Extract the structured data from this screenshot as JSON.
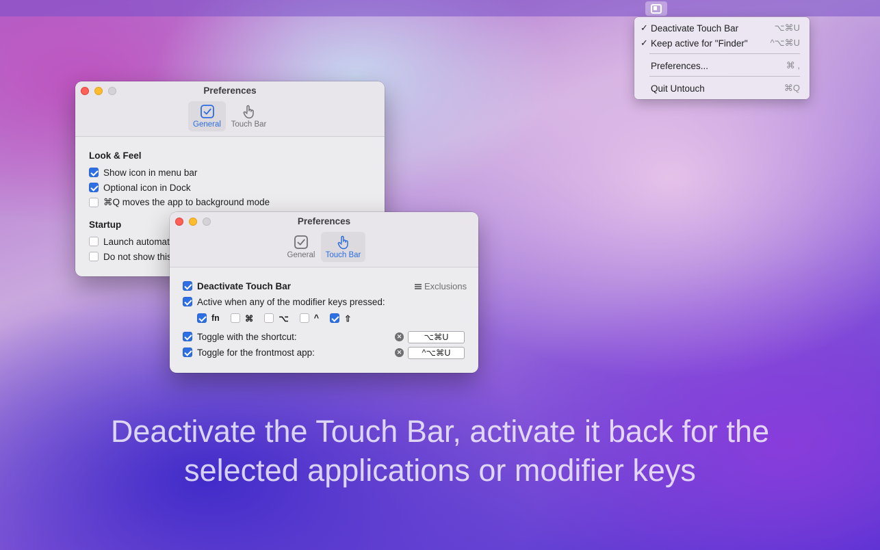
{
  "menubar": {
    "icon": "untouch-app-icon"
  },
  "menu": {
    "items": [
      {
        "checked": true,
        "label": "Deactivate Touch Bar",
        "shortcut": "⌥⌘U"
      },
      {
        "checked": true,
        "label": "Keep active for \"Finder\"",
        "shortcut": "^⌥⌘U"
      },
      {
        "checked": false,
        "label": "Preferences...",
        "shortcut": "⌘ ,"
      },
      {
        "checked": false,
        "label": "Quit Untouch",
        "shortcut": "⌘Q"
      }
    ],
    "check_glyph": "✓"
  },
  "window_general": {
    "title": "Preferences",
    "tabs": [
      {
        "label": "General",
        "icon": "checkbox-icon",
        "active": true
      },
      {
        "label": "Touch Bar",
        "icon": "hand-pointer-icon",
        "active": false
      }
    ],
    "look_feel": {
      "title": "Look & Feel",
      "options": [
        {
          "label": "Show icon in menu bar",
          "checked": true
        },
        {
          "label": "Optional icon in Dock",
          "checked": true
        },
        {
          "label": "⌘Q moves the app to background mode",
          "checked": false
        }
      ]
    },
    "startup": {
      "title": "Startup",
      "options": [
        {
          "label": "Launch automat",
          "checked": false
        },
        {
          "label": "Do not show this",
          "checked": false
        }
      ]
    }
  },
  "window_touchbar": {
    "title": "Preferences",
    "tabs": [
      {
        "label": "General",
        "icon": "checkbox-icon",
        "active": false
      },
      {
        "label": "Touch Bar",
        "icon": "hand-pointer-icon",
        "active": true
      }
    ],
    "deactivate": {
      "label": "Deactivate Touch Bar",
      "checked": true
    },
    "exclusions_label": "Exclusions",
    "active_modifiers": {
      "label": "Active when any of the modifier keys pressed:",
      "checked": true
    },
    "modifiers": [
      {
        "label": "fn",
        "checked": true
      },
      {
        "label": "⌘",
        "checked": false
      },
      {
        "label": "⌥",
        "checked": false
      },
      {
        "label": "^",
        "checked": false
      },
      {
        "label": "⇧",
        "checked": true
      }
    ],
    "toggle_shortcut": {
      "label": "Toggle with the shortcut:",
      "checked": true,
      "value": "⌥⌘U"
    },
    "toggle_frontmost": {
      "label": "Toggle for the frontmost app:",
      "checked": true,
      "value": "^⌥⌘U"
    },
    "clear_glyph": "✕"
  },
  "tagline": {
    "line1": "Deactivate the Touch Bar, activate it back for the",
    "line2": "selected applications or modifier keys"
  }
}
